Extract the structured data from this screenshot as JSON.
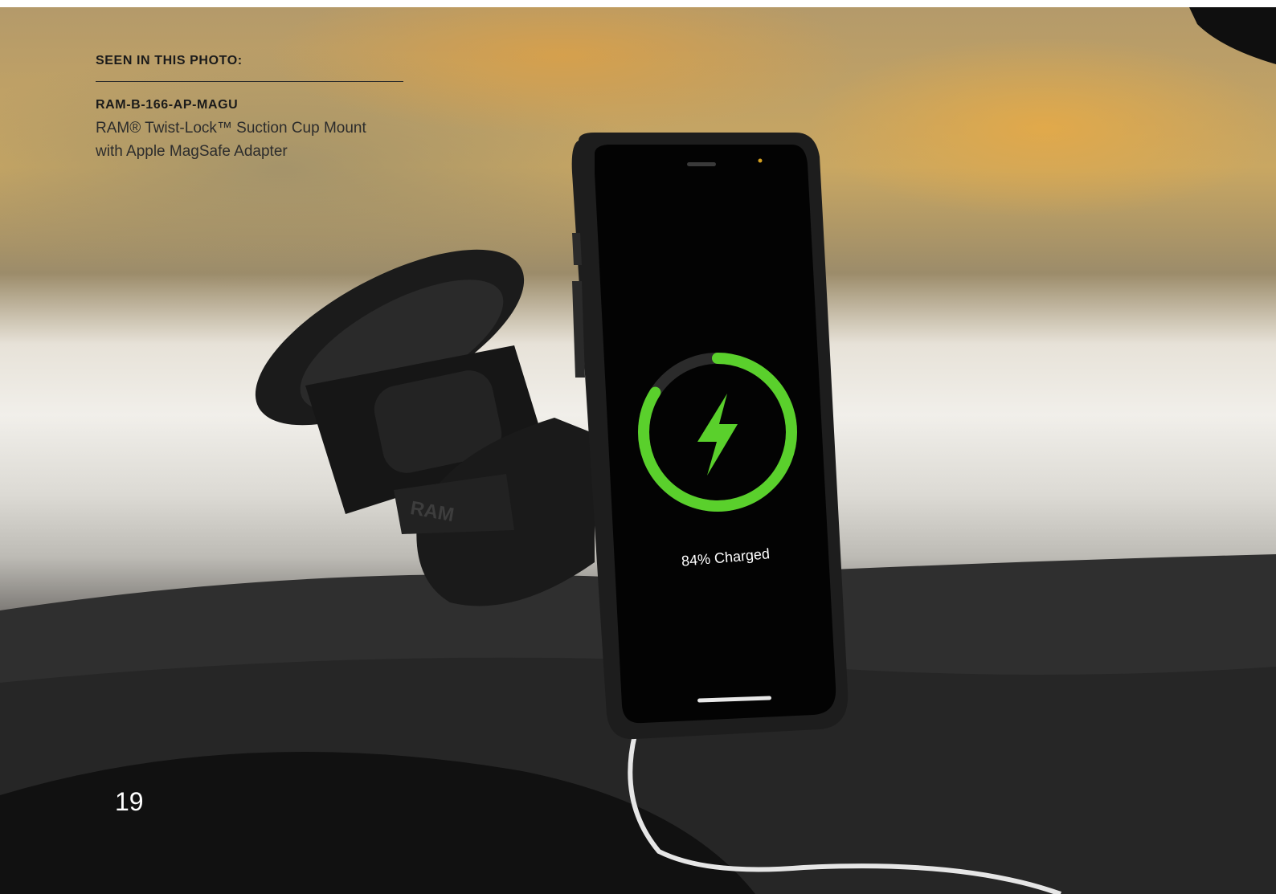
{
  "caption": {
    "heading": "SEEN IN THIS PHOTO:",
    "sku": "RAM-B-166-AP-MAGU",
    "description_line1": "RAM® Twist-Lock™ Suction Cup Mount",
    "description_line2": "with Apple MagSafe Adapter"
  },
  "phone_screen": {
    "charge_status": "84% Charged",
    "charge_percent": 84,
    "ring_color": "#5ad02c",
    "icon": "lightning-bolt-icon"
  },
  "mount_branding": "RAM",
  "page_number": "19",
  "colors": {
    "text_dark": "#1a1a1a",
    "page_number": "#ffffff",
    "charge_green": "#5ad02c"
  }
}
